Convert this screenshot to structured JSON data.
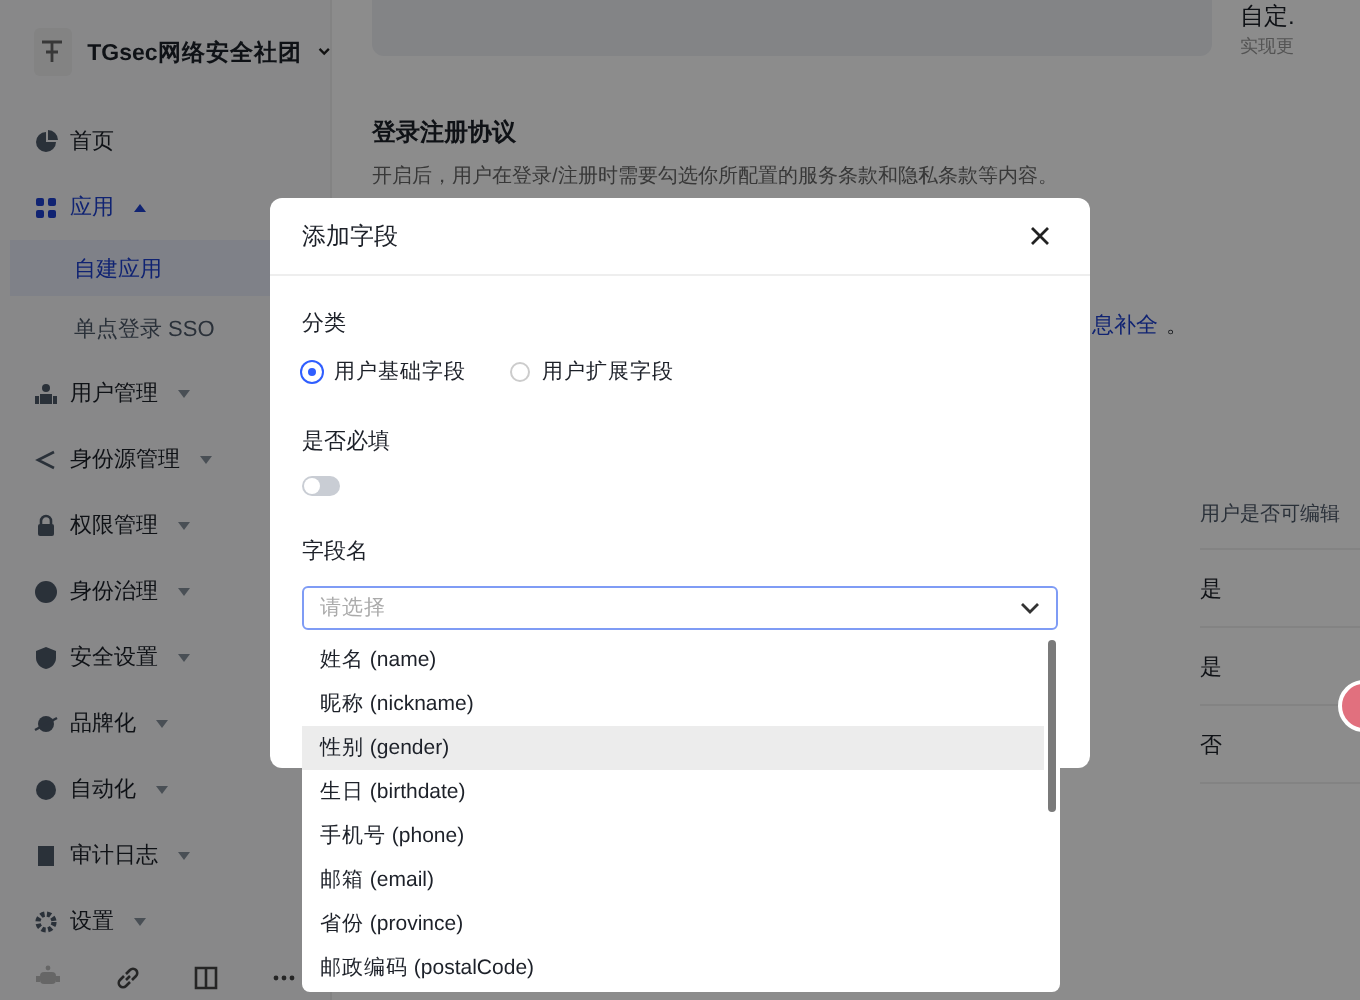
{
  "org": {
    "name": "TGsec网络安全社团"
  },
  "sidebar": {
    "items": [
      {
        "label": "首页",
        "kind": "link"
      },
      {
        "label": "应用",
        "kind": "group",
        "expanded": true,
        "children": [
          {
            "label": "自建应用",
            "selected": true
          },
          {
            "label": "单点登录 SSO",
            "selected": false
          }
        ]
      },
      {
        "label": "用户管理",
        "kind": "group",
        "expanded": false
      },
      {
        "label": "身份源管理",
        "kind": "group",
        "expanded": false
      },
      {
        "label": "权限管理",
        "kind": "group",
        "expanded": false
      },
      {
        "label": "身份治理",
        "kind": "group",
        "expanded": false
      },
      {
        "label": "安全设置",
        "kind": "group",
        "expanded": false
      },
      {
        "label": "品牌化",
        "kind": "group",
        "expanded": false
      },
      {
        "label": "自动化",
        "kind": "group",
        "expanded": false
      },
      {
        "label": "审计日志",
        "kind": "group",
        "expanded": false
      },
      {
        "label": "设置",
        "kind": "group",
        "expanded": false
      }
    ]
  },
  "main": {
    "side_title": "自定.",
    "side_text": "实现更",
    "agreement": {
      "title": "登录注册协议",
      "description": "开启后，用户在登录/注册时需要勾选你所配置的服务条款和隐私条款等内容。"
    },
    "link": "息补全",
    "link_suffix": "。",
    "table": {
      "column": "用户是否可编辑",
      "rows": [
        "是",
        "是",
        "否"
      ]
    }
  },
  "dialog": {
    "title": "添加字段",
    "category": {
      "label": "分类",
      "options": [
        {
          "label": "用户基础字段",
          "selected": true
        },
        {
          "label": "用户扩展字段",
          "selected": false
        }
      ]
    },
    "required": {
      "label": "是否必填",
      "on": false
    },
    "field": {
      "label": "字段名",
      "placeholder": "请选择",
      "focused": true,
      "options": [
        {
          "label": "姓名 (name)",
          "highlighted": false
        },
        {
          "label": "昵称 (nickname)",
          "highlighted": false
        },
        {
          "label": "性别 (gender)",
          "highlighted": true
        },
        {
          "label": "生日 (birthdate)",
          "highlighted": false
        },
        {
          "label": "手机号 (phone)",
          "highlighted": false
        },
        {
          "label": "邮箱 (email)",
          "highlighted": false
        },
        {
          "label": "省份 (province)",
          "highlighted": false
        },
        {
          "label": "邮政编码 (postalCode)",
          "highlighted": false
        }
      ]
    }
  }
}
